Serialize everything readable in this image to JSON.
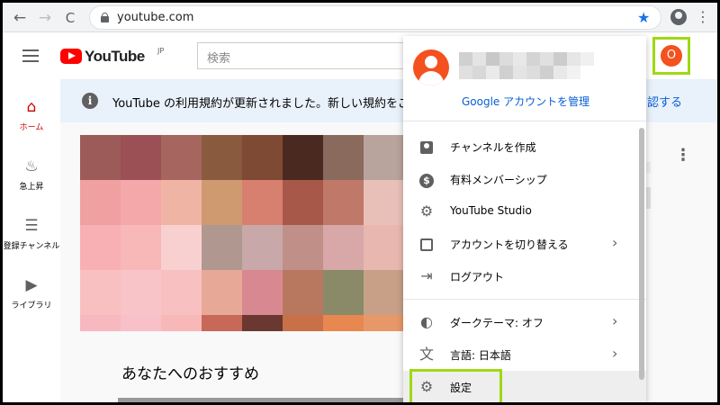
{
  "browser": {
    "url": "youtube.com",
    "back_glyph": "←",
    "forward_glyph": "→",
    "reload_glyph": "C",
    "star_glyph": "★",
    "menu_glyph": "⋮"
  },
  "header": {
    "logo_text": "YouTube",
    "logo_region": "JP",
    "search_placeholder": "検索",
    "avatar_letter": "O"
  },
  "leftnav": {
    "items": [
      {
        "label": "ホーム",
        "icon": "home-icon",
        "glyph": "⌂",
        "active": true
      },
      {
        "label": "急上昇",
        "icon": "fire-icon",
        "glyph": "♨",
        "active": false
      },
      {
        "label": "登録チャンネル",
        "icon": "subscriptions-icon",
        "glyph": "☰",
        "active": false
      },
      {
        "label": "ライブラリ",
        "icon": "library-icon",
        "glyph": "▶",
        "active": false
      }
    ]
  },
  "notice": {
    "icon_glyph": "i",
    "text": "YouTube の利用規約が更新されました。新しい規約をご確認ください。",
    "action": "認する"
  },
  "main": {
    "recommended_title": "あなたへのおすすめ",
    "kebab_glyph": "⋮"
  },
  "dropdown": {
    "manage_account": "Google アカウントを管理",
    "items": [
      {
        "label": "チャンネルを作成",
        "icon": "person-box-icon",
        "chevron": ""
      },
      {
        "label": "有料メンバーシップ",
        "icon": "dollar-icon",
        "chevron": ""
      },
      {
        "label": "YouTube Studio",
        "icon": "gear-icon",
        "chevron": ""
      },
      {
        "label": "アカウントを切り替える",
        "icon": "switch-account-icon",
        "chevron": "›"
      },
      {
        "label": "ログアウト",
        "icon": "logout-icon",
        "chevron": ""
      },
      {
        "label": "ダークテーマ: オフ",
        "icon": "dark-theme-icon",
        "chevron": "›"
      },
      {
        "label": "言語: 日本語",
        "icon": "translate-icon",
        "chevron": "›"
      },
      {
        "label": "設定",
        "icon": "settings-gear-icon",
        "chevron": ""
      }
    ]
  },
  "colors": {
    "youtube_red": "#ff0000",
    "highlight_green": "#a0d911",
    "avatar_orange": "#f4511e",
    "link_blue": "#065fd4"
  }
}
